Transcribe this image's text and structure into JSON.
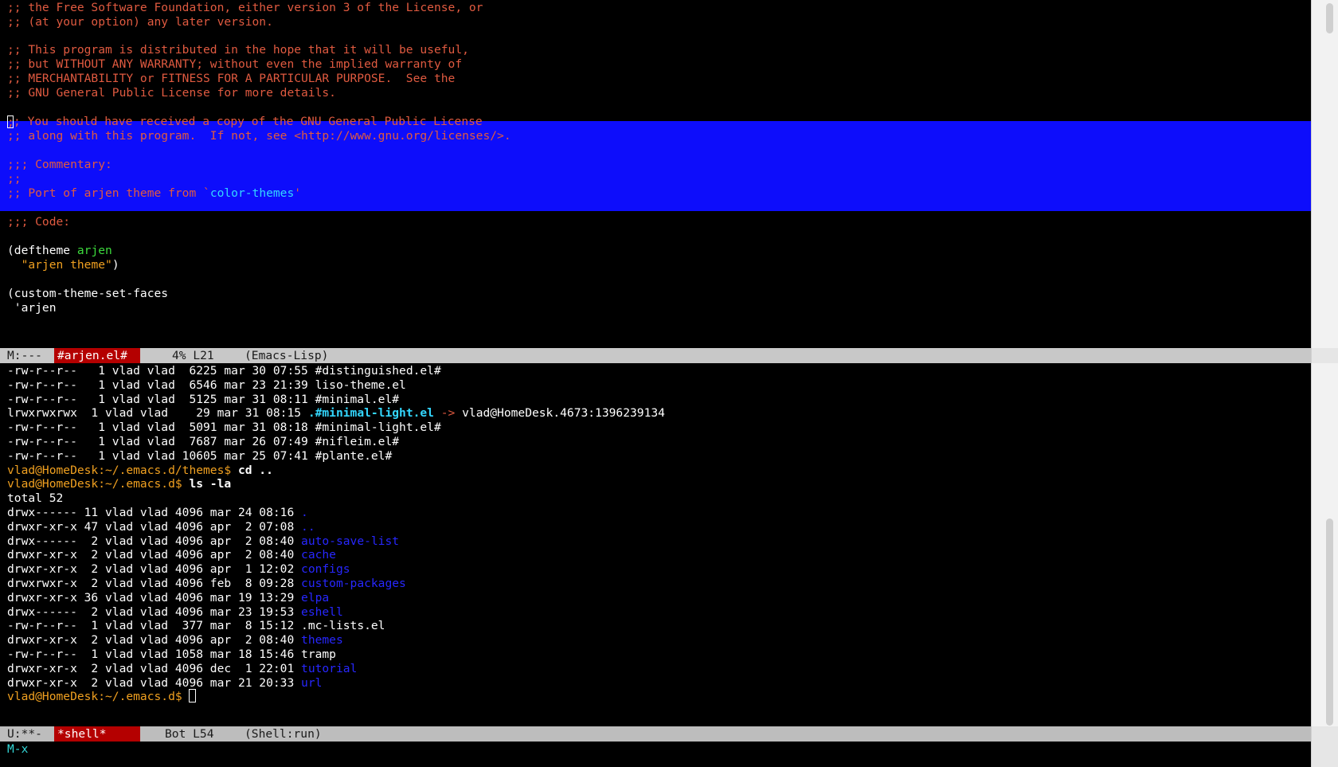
{
  "top_buffer": {
    "lines_before_region": [
      ";; the Free Software Foundation, either version 3 of the License, or",
      ";; (at your option) any later version.",
      "",
      ";; This program is distributed in the hope that it will be useful,",
      ";; but WITHOUT ANY WARRANTY; without even the implied warranty of",
      ";; MERCHANTABILITY or FITNESS FOR A PARTICULAR PURPOSE.  See the",
      ";; GNU General Public License for more details.",
      ""
    ],
    "region": {
      "line1_cursor_char": ";",
      "line1_rest": "; You should have received a copy of the GNU General Public License",
      "line2": ";; along with this program.  If not, see <http://www.gnu.org/licenses/>.",
      "line3": "",
      "line4": ";;; Commentary:",
      "line5": ";;",
      "line6_prefix": ";; Port of arjen theme from `",
      "line6_quoted": "color-themes",
      "line6_suffix": "'"
    },
    "after_region": {
      "blank1": "",
      "code_comment": ";;; Code:",
      "blank2": "",
      "deftheme_open": "(deftheme ",
      "deftheme_name": "arjen",
      "string_indent": "  ",
      "string_value": "\"arjen theme\"",
      "string_close": ")",
      "blank3": "",
      "custom_faces": "(custom-theme-set-faces",
      "quoted_arjen": " 'arjen"
    }
  },
  "top_modeline": {
    "state": "M:---",
    "buffer_name": "#arjen.el#",
    "position": "4% L21",
    "mode": "(Emacs-Lisp)"
  },
  "shell_buffer": {
    "listing1": [
      {
        "perms": "-rw-r--r--",
        "links": " 1",
        "owner": "vlad",
        "group": "vlad",
        "size": " 6225",
        "date": "mar 30 07:55",
        "name": "#distinguished.el#",
        "kind": "file"
      },
      {
        "perms": "-rw-r--r--",
        "links": " 1",
        "owner": "vlad",
        "group": "vlad",
        "size": " 6546",
        "date": "mar 23 21:39",
        "name": "liso-theme.el",
        "kind": "file"
      },
      {
        "perms": "-rw-r--r--",
        "links": " 1",
        "owner": "vlad",
        "group": "vlad",
        "size": " 5125",
        "date": "mar 31 08:11",
        "name": "#minimal.el#",
        "kind": "file"
      }
    ],
    "symlink_row": {
      "prefix": "lrwxrwxrwx  1 vlad vlad    29 mar 31 08:15 ",
      "name": ".#minimal-light.el",
      "arrow": " -> ",
      "target": "vlad@HomeDesk.4673:1396239134"
    },
    "listing2": [
      {
        "perms": "-rw-r--r--",
        "links": " 1",
        "owner": "vlad",
        "group": "vlad",
        "size": " 5091",
        "date": "mar 31 08:18",
        "name": "#minimal-light.el#",
        "kind": "file"
      },
      {
        "perms": "-rw-r--r--",
        "links": " 1",
        "owner": "vlad",
        "group": "vlad",
        "size": " 7687",
        "date": "mar 26 07:49",
        "name": "#nifleim.el#",
        "kind": "file"
      },
      {
        "perms": "-rw-r--r--",
        "links": " 1",
        "owner": "vlad",
        "group": "vlad",
        "size": "10605",
        "date": "mar 25 07:41",
        "name": "#plante.el#",
        "kind": "file"
      }
    ],
    "prompt1": "vlad@HomeDesk:~/.emacs.d/themes$ ",
    "cmd1": "cd ..",
    "prompt2": "vlad@HomeDesk:~/.emacs.d$ ",
    "cmd2": "ls -la",
    "total": "total 52",
    "listing3": [
      {
        "meta": "drwx------ 11 vlad vlad 4096 mar 24 08:16 ",
        "name": ".",
        "kind": "dir"
      },
      {
        "meta": "drwxr-xr-x 47 vlad vlad 4096 apr  2 07:08 ",
        "name": "..",
        "kind": "dir"
      },
      {
        "meta": "drwx------  2 vlad vlad 4096 apr  2 08:40 ",
        "name": "auto-save-list",
        "kind": "dir"
      },
      {
        "meta": "drwxr-xr-x  2 vlad vlad 4096 apr  2 08:40 ",
        "name": "cache",
        "kind": "dir"
      },
      {
        "meta": "drwxr-xr-x  2 vlad vlad 4096 apr  1 12:02 ",
        "name": "configs",
        "kind": "dir"
      },
      {
        "meta": "drwxrwxr-x  2 vlad vlad 4096 feb  8 09:28 ",
        "name": "custom-packages",
        "kind": "dir"
      },
      {
        "meta": "drwxr-xr-x 36 vlad vlad 4096 mar 19 13:29 ",
        "name": "elpa",
        "kind": "dir"
      },
      {
        "meta": "drwx------  2 vlad vlad 4096 mar 23 19:53 ",
        "name": "eshell",
        "kind": "dir"
      },
      {
        "meta": "-rw-r--r--  1 vlad vlad  377 mar  8 15:12 ",
        "name": ".mc-lists.el",
        "kind": "file"
      },
      {
        "meta": "drwxr-xr-x  2 vlad vlad 4096 apr  2 08:40 ",
        "name": "themes",
        "kind": "dir"
      },
      {
        "meta": "-rw-r--r--  1 vlad vlad 1058 mar 18 15:46 ",
        "name": "tramp",
        "kind": "file"
      },
      {
        "meta": "drwxr-xr-x  2 vlad vlad 4096 dec  1 22:01 ",
        "name": "tutorial",
        "kind": "dir"
      },
      {
        "meta": "drwxr-xr-x  2 vlad vlad 4096 mar 21 20:33 ",
        "name": "url",
        "kind": "dir"
      }
    ],
    "prompt3": "vlad@HomeDesk:~/.emacs.d$ "
  },
  "bottom_modeline": {
    "state": "U:**-",
    "buffer_name": "*shell*",
    "position": "Bot L54",
    "mode": "(Shell:run)"
  },
  "minibuffer": {
    "text": "M-x"
  },
  "colors": {
    "background": "#000000",
    "comment": "#e05a40",
    "region": "#0d0dfb",
    "function_name": "#3ddb3d",
    "string": "#f0a020",
    "prompt": "#f0a020",
    "directory": "#2727ff",
    "symlink": "#33d7ff",
    "modeline_bg": "#c8c8c8",
    "modeline_buffer_bg": "#b40000"
  }
}
